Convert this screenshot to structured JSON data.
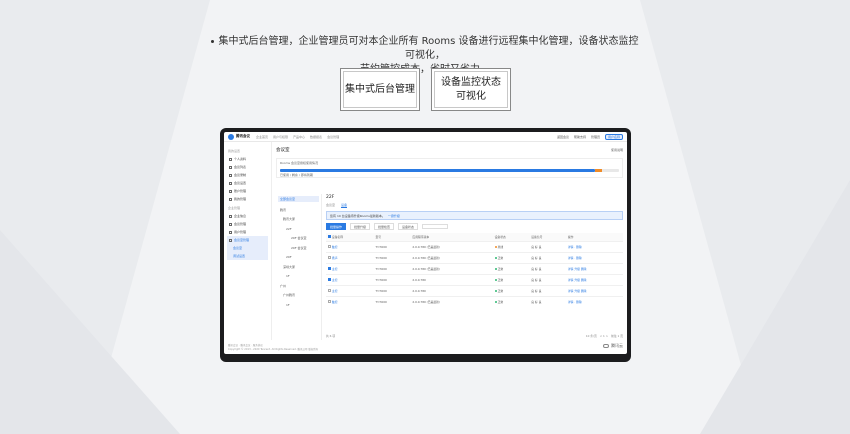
{
  "headline": {
    "line1": "集中式后台管理，企业管理员可对本企业所有 Rooms 设备进行远程集中化管理，设备状态监控可视化，",
    "line2": "节约管控成本，省时又省力。"
  },
  "features": [
    {
      "label_line1": "集中式后台管理",
      "label_line2": ""
    },
    {
      "label_line1": "设备监控状态",
      "label_line2": "可视化"
    }
  ],
  "app": {
    "logo": "腾讯会议",
    "brand_small": "腾讯云",
    "nav": [
      "企业首页",
      "用户与权限",
      "产品中心",
      "数据报表",
      "会议管理"
    ],
    "nav_right": [
      "返回会议",
      "帮助支持",
      "管理员",
      "用户名称"
    ],
    "side_groups": [
      {
        "title": "我的设置",
        "items": [
          "个人资料",
          "会议列表",
          "会议录制",
          "会议设置",
          "账户管理",
          "我的管理"
        ]
      },
      {
        "title": "企业管理",
        "items": [
          "企业信息",
          "会议管理",
          "用户管理"
        ]
      }
    ],
    "side_sub": [
      "会议室管理",
      "会议室",
      "调试设置"
    ],
    "page_title": "会议室",
    "page_right": "使用说明",
    "usage_line1": "Rooms 会议室授权使用情况",
    "usage_line2": "已使用 / 剩余 / 即将到期",
    "usage_fraction": 0.93,
    "usage_alert_fraction": 0.02,
    "tree_selected": "全部会议室",
    "tree": [
      "腾讯",
      "腾讯大厦",
      "22F",
      "20F 会议室",
      "20F 会议室",
      "20F",
      "深圳大厦",
      "1F",
      "广州",
      "广州腾讯",
      "1F"
    ],
    "floor": "22F",
    "tabs": [
      "会议室",
      "设备"
    ],
    "tip": "您有 10 台设备待升级Rooms最新版本。",
    "tip_link": "一键升级",
    "toolbar": [
      "批量操作",
      "批量升级",
      "批量检查",
      "设备状态"
    ],
    "table_headers": [
      "设备名称",
      "型号",
      "应用程序版本",
      "设备状态",
      "设备信号",
      "操作"
    ],
    "rows": [
      {
        "name": "触控",
        "model": "TY-TO00",
        "version": "2.0.0.780 (已是最新)",
        "status": "离线",
        "status_color": "#f08c28",
        "checked": false,
        "signal": "良 好 良",
        "ops": "详情  ·  删除"
      },
      {
        "name": "扬声",
        "model": "TY-TO00",
        "version": "2.0.0.780 (已是最新)",
        "status": "正常",
        "status_color": "#2eb872",
        "checked": false,
        "signal": "良 好 良",
        "ops": "详情  ·  删除"
      },
      {
        "name": "主控",
        "model": "TY-TO00",
        "version": "2.0.0.780 (已是最新)",
        "status": "正常",
        "status_color": "#2eb872",
        "checked": true,
        "signal": "良 好 良",
        "ops": "详情  升级  删除"
      },
      {
        "name": "主控",
        "model": "TY-TO00",
        "version": "2.0.0.780",
        "status": "正常",
        "status_color": "#2eb872",
        "checked": true,
        "signal": "良 好 良",
        "ops": "详情  升级  删除"
      },
      {
        "name": "主控",
        "model": "TY-TO00",
        "version": "2.0.0.780",
        "status": "正常",
        "status_color": "#2eb872",
        "checked": false,
        "signal": "良 好 良",
        "ops": "详情  升级  删除"
      },
      {
        "name": "触控",
        "model": "TY-TO00",
        "version": "2.0.0.780 (已是最新)",
        "status": "正常",
        "status_color": "#2eb872",
        "checked": false,
        "signal": "良 好 良",
        "ops": "详情  ·  删除"
      }
    ],
    "pager_left": "共 6 项",
    "pager_right": [
      "10 条/页",
      "< 1 >",
      "前往 1 页"
    ],
    "footer_line1": "腾讯会议 · 腾讯会议 · 服务协议",
    "footer_line2": "Copyright © 2013 - 2020 Tencent. All Rights Reserved. 腾讯公司 版权所有",
    "accent": "#2a7ae2"
  }
}
